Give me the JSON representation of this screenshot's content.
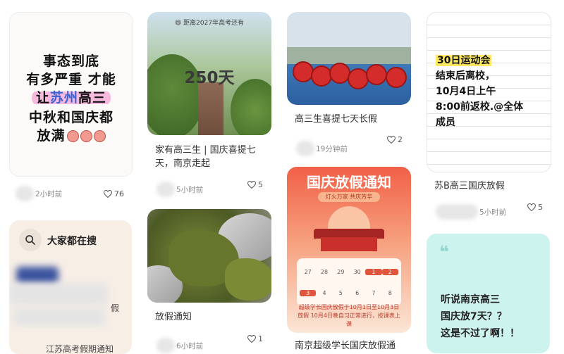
{
  "cards": {
    "c1": {
      "lines": [
        "事态到底",
        "有多严重 才能",
        "让",
        "苏州",
        "高三",
        "中秋和国庆都",
        "放满"
      ],
      "time": "2小时前",
      "likes": "76"
    },
    "c2": {
      "header": "😄 距离2027年高考还有",
      "big": "250天",
      "title": "家有高三生 | 国庆喜提七天，南京走起",
      "time": "5小时前",
      "likes": "5"
    },
    "c3": {
      "title": "高三生喜提七天长假",
      "time": "19分钟前",
      "likes": "2"
    },
    "c4": {
      "note": [
        "30日运动会",
        "结束后离校，",
        "10月4日上午",
        "8:00前返校.@全体",
        "成员"
      ],
      "title": "苏B高三国庆放假",
      "time": "5小时前",
      "likes": "5"
    },
    "c5": {
      "heading": "大家都在搜",
      "items": [
        "假",
        "江苏高考假期通知"
      ]
    },
    "c6": {
      "title": "放假通知",
      "time": "6小时前",
      "likes": "1"
    },
    "c7": {
      "banner": "国庆放假通知",
      "sub": "灯火万家 共庆芳华",
      "calendar": [
        "27",
        "28",
        "29",
        "30",
        "1",
        "2",
        "3",
        "4",
        "5",
        "6",
        "7",
        "8"
      ],
      "footer": "超级学长国庆放假于10月1日至10月3日放假 10月4日晚自习正常进行，按课表上课",
      "title": "南京超级学长国庆放假通"
    },
    "c8": {
      "quote": "❝",
      "lines": [
        "听说南京高三",
        "国庆放7天？？",
        "这是不过了啊！！"
      ]
    }
  },
  "colors": {
    "highlight_pink": "#f7b9dd",
    "note_yellow": "#ffe862",
    "mint": "#cdf3ef",
    "poster_red": "#f16048"
  }
}
